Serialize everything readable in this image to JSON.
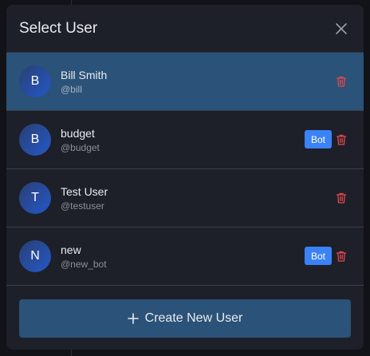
{
  "modal": {
    "title": "Select User",
    "close_icon": "close-icon"
  },
  "users": [
    {
      "initial": "B",
      "name": "Bill Smith",
      "handle": "@bill",
      "bot": false,
      "selected": true
    },
    {
      "initial": "B",
      "name": "budget",
      "handle": "@budget",
      "bot": true,
      "bot_label": "Bot",
      "selected": false
    },
    {
      "initial": "T",
      "name": "Test User",
      "handle": "@testuser",
      "bot": false,
      "selected": false
    },
    {
      "initial": "N",
      "name": "new",
      "handle": "@new_bot",
      "bot": true,
      "bot_label": "Bot",
      "selected": false
    }
  ],
  "footer": {
    "create_label": "Create New User",
    "create_icon": "plus-icon"
  },
  "colors": {
    "modal_bg": "#1d2029",
    "selected_row": "#2b5278",
    "bot_badge": "#3b82f6",
    "delete_icon": "#e5484d",
    "avatar_gradient_start": "#2a3f73",
    "avatar_gradient_end": "#2458c9"
  }
}
